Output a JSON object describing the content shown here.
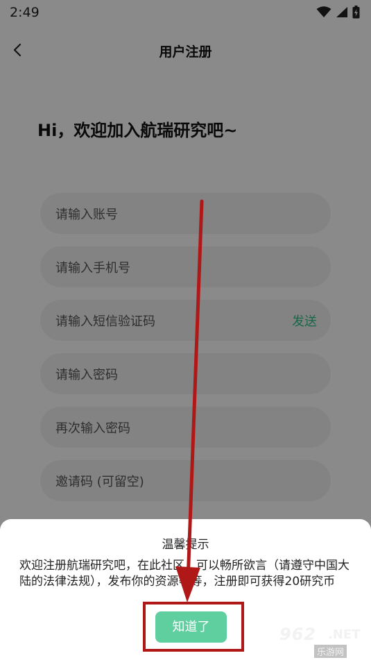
{
  "status_bar": {
    "time": "2:49"
  },
  "header": {
    "title": "用户注册"
  },
  "greeting": "Hi，欢迎加入航瑞研究吧~",
  "form": {
    "account_placeholder": "请输入账号",
    "phone_placeholder": "请输入手机号",
    "sms_placeholder": "请输入短信验证码",
    "send_label": "发送",
    "password_placeholder": "请输入密码",
    "confirm_password_placeholder": "再次输入密码",
    "invite_placeholder": "邀请码 (可留空)"
  },
  "dialog": {
    "title": "温馨提示",
    "body": "欢迎注册航瑞研究吧，在此社区，可以畅所欲言（请遵守中国大陆的法律法规），发布你的资源等等，注册即可获得20研究币",
    "ok_label": "知道了"
  },
  "watermark": {
    "main": "962",
    "suffix": ".NET",
    "sub": "乐游网"
  },
  "colors": {
    "accent": "#2fbf87",
    "button": "#5fcfa0",
    "annotation": "#b01818"
  }
}
